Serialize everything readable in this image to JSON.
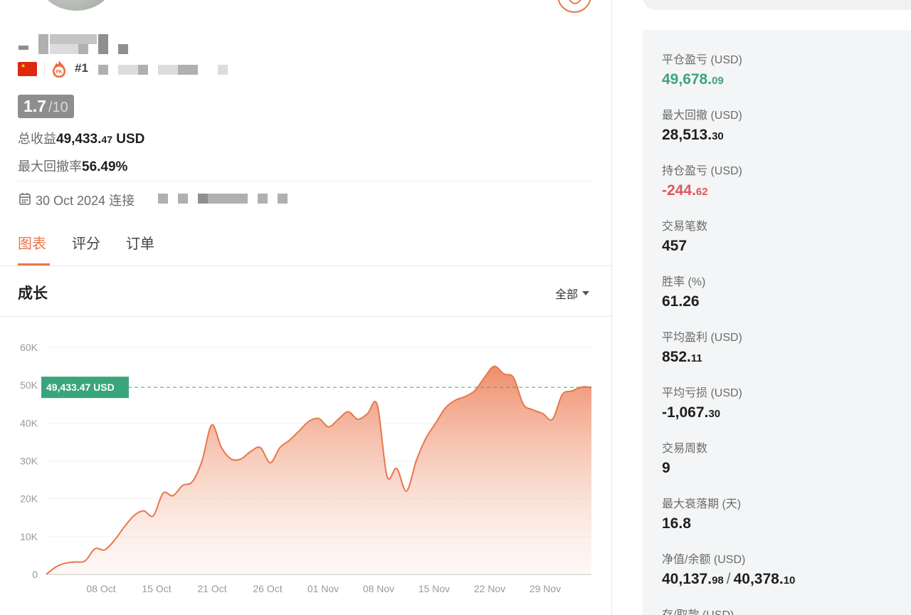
{
  "profile": {
    "rank": "#1",
    "score": "1.7",
    "score_max": "/10",
    "total_profit_label": "总收益",
    "total_profit_int": "49,433.",
    "total_profit_dec": "47",
    "total_profit_unit": " USD",
    "max_drawdown_rate_label": "最大回撤率",
    "max_drawdown_rate": "56.49%",
    "connected_date": "30 Oct 2024 连接"
  },
  "tabs": [
    {
      "label": "图表",
      "active": true
    },
    {
      "label": "评分",
      "active": false
    },
    {
      "label": "订单",
      "active": false
    }
  ],
  "growth": {
    "title": "成长",
    "range_label": "全部"
  },
  "colors": {
    "accent": "#e8774d",
    "positive": "#3aa57c",
    "negative": "#e0565b"
  },
  "chart_data": {
    "type": "area",
    "x_ticks": [
      "08 Oct",
      "15 Oct",
      "21 Oct",
      "26 Oct",
      "01 Nov",
      "08 Nov",
      "15 Nov",
      "22 Nov",
      "29 Nov"
    ],
    "y_ticks": [
      "60K",
      "50K",
      "40K",
      "30K",
      "20K",
      "10K",
      "0"
    ],
    "ylim": [
      0,
      60000
    ],
    "current_value_label": "49,433.47 USD",
    "current_value": 49433.47,
    "x_index_range": [
      0,
      69
    ],
    "values": [
      0,
      2000,
      3000,
      3300,
      3600,
      6800,
      6500,
      9000,
      12500,
      15500,
      16800,
      15500,
      21500,
      20800,
      23500,
      24500,
      30000,
      39500,
      33500,
      30500,
      30500,
      32500,
      33500,
      29500,
      33500,
      35500,
      38000,
      40500,
      41200,
      39000,
      41000,
      43000,
      41000,
      42500,
      44800,
      26000,
      28000,
      22000,
      30000,
      36000,
      40000,
      44000,
      46000,
      47000,
      48500,
      52000,
      55000,
      53000,
      52000,
      45000,
      43500,
      42500,
      41000,
      47500,
      48500,
      49500,
      49433
    ]
  },
  "stats": [
    {
      "label": "平仓盈亏 (USD)",
      "int": "49,678.",
      "dec": "09",
      "tone": "pos"
    },
    {
      "label": "最大回撤 (USD)",
      "int": "28,513.",
      "dec": "30",
      "tone": ""
    },
    {
      "label": "持仓盈亏 (USD)",
      "int": "-244.",
      "dec": "62",
      "tone": "neg"
    },
    {
      "label": "交易笔数",
      "int": "457",
      "dec": "",
      "tone": ""
    },
    {
      "label": "胜率 (%)",
      "int": "61.26",
      "dec": "",
      "tone": ""
    },
    {
      "label": "平均盈利 (USD)",
      "int": "852.",
      "dec": "11",
      "tone": ""
    },
    {
      "label": "平均亏损 (USD)",
      "int": "-1,067.",
      "dec": "30",
      "tone": ""
    },
    {
      "label": "交易周数",
      "int": "9",
      "dec": "",
      "tone": ""
    },
    {
      "label": "最大衰落期 (天)",
      "int": "16.8",
      "dec": "",
      "tone": ""
    },
    {
      "label": "净值/余额 (USD)",
      "int": "40,137.",
      "dec": "98",
      "tone": "",
      "int2": "40,378.",
      "dec2": "10"
    },
    {
      "label": "存/取款 (USD)",
      "int": "",
      "dec": "",
      "tone": ""
    }
  ]
}
